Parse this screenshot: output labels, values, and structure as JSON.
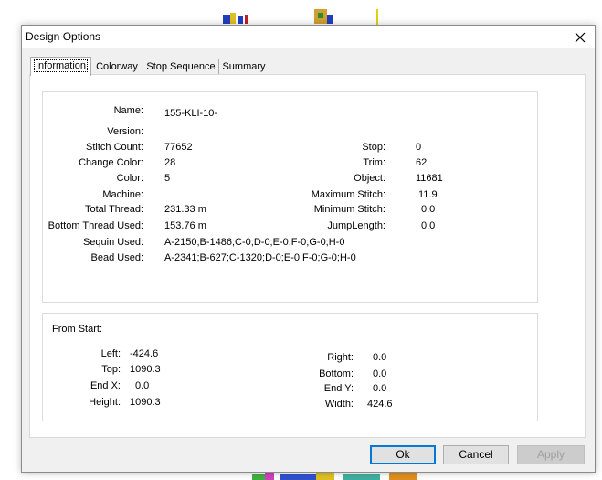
{
  "dialog": {
    "title": "Design Options",
    "close_glyph": "×"
  },
  "tabs": [
    {
      "label": "Information",
      "active": true
    },
    {
      "label": "Colorway",
      "active": false
    },
    {
      "label": "Stop Sequence",
      "active": false
    },
    {
      "label": "Summary",
      "active": false
    }
  ],
  "info": {
    "name_label": "Name:",
    "name_value": "155-KLI-10-",
    "version_label": "Version:",
    "version_value": "",
    "stitch_count_label": "Stitch Count:",
    "stitch_count_value": "77652",
    "change_color_label": "Change Color:",
    "change_color_value": "28",
    "color_label": "Color:",
    "color_value": "5",
    "machine_label": "Machine:",
    "machine_value": "",
    "total_thread_label": "Total Thread:",
    "total_thread_value": "231.33 m",
    "bottom_thread_label": "Bottom Thread Used:",
    "bottom_thread_value": "153.76 m",
    "sequin_label": "Sequin Used:",
    "sequin_value": "A-2150;B-1486;C-0;D-0;E-0;F-0;G-0;H-0",
    "bead_label": "Bead Used:",
    "bead_value": "A-2341;B-627;C-1320;D-0;E-0;F-0;G-0;H-0",
    "stop_label": "Stop:",
    "stop_value": "0",
    "trim_label": "Trim:",
    "trim_value": "62",
    "object_label": "Object:",
    "object_value": "11681",
    "max_stitch_label": "Maximum Stitch:",
    "max_stitch_value": "11.9",
    "min_stitch_label": "Minimum Stitch:",
    "min_stitch_value": "0.0",
    "jump_length_label": "JumpLength:",
    "jump_length_value": "0.0"
  },
  "from_start": {
    "heading": "From Start:",
    "left_label": "Left:",
    "left_value": "-424.6",
    "top_label": "Top:",
    "top_value": "1090.3",
    "endx_label": "End X:",
    "endx_value": "0.0",
    "height_label": "Height:",
    "height_value": "1090.3",
    "right_label": "Right:",
    "right_value": "0.0",
    "bottom_label": "Bottom:",
    "bottom_value": "0.0",
    "endy_label": "End Y:",
    "endy_value": "0.0",
    "width_label": "Width:",
    "width_value": "424.6"
  },
  "buttons": {
    "ok": "Ok",
    "cancel": "Cancel",
    "apply": "Apply"
  },
  "colors": {
    "accent": "#0078d7",
    "dialog_bg": "#f0f0f0",
    "panel_bg": "#ffffff"
  }
}
